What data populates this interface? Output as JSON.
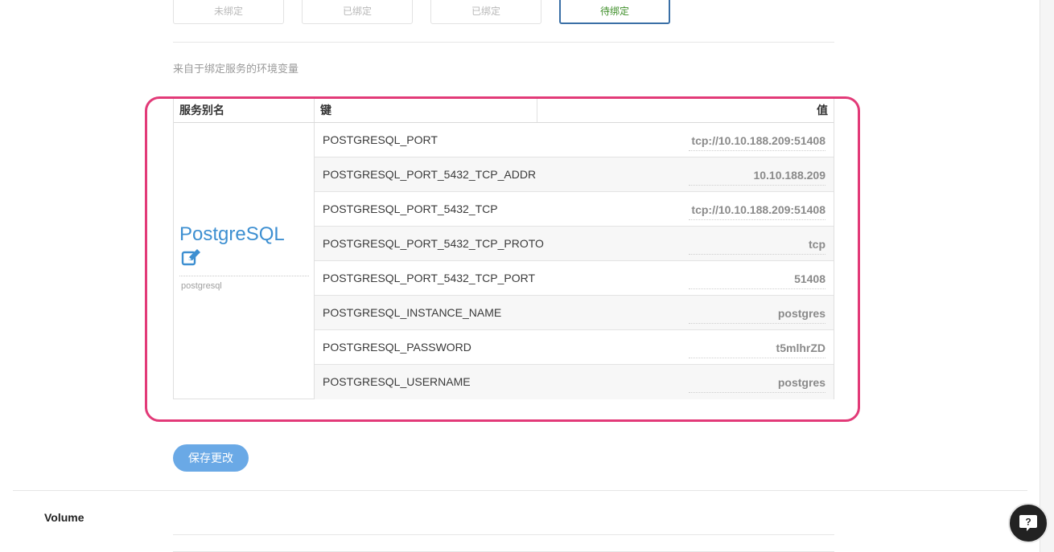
{
  "binding_tabs": [
    {
      "label": "未绑定",
      "active": false
    },
    {
      "label": "已绑定",
      "active": false
    },
    {
      "label": "已绑定",
      "active": false
    },
    {
      "label": "待绑定",
      "active": true
    }
  ],
  "env_section": {
    "label": "来自于绑定服务的环境变量",
    "table": {
      "headers": {
        "alias": "服务别名",
        "key": "键",
        "value": "值"
      },
      "service": {
        "name": "PostgreSQL",
        "id": "postgresql"
      },
      "rows": [
        {
          "key": "POSTGRESQL_PORT",
          "value": "tcp://10.10.188.209:51408"
        },
        {
          "key": "POSTGRESQL_PORT_5432_TCP_ADDR",
          "value": "10.10.188.209"
        },
        {
          "key": "POSTGRESQL_PORT_5432_TCP",
          "value": "tcp://10.10.188.209:51408"
        },
        {
          "key": "POSTGRESQL_PORT_5432_TCP_PROTO",
          "value": "tcp"
        },
        {
          "key": "POSTGRESQL_PORT_5432_TCP_PORT",
          "value": "51408"
        },
        {
          "key": "POSTGRESQL_INSTANCE_NAME",
          "value": "postgres"
        },
        {
          "key": "POSTGRESQL_PASSWORD",
          "value": "t5mlhrZD"
        },
        {
          "key": "POSTGRESQL_USERNAME",
          "value": "postgres"
        }
      ]
    }
  },
  "save_button": {
    "label": "保存更改"
  },
  "volume": {
    "title": "Volume"
  },
  "help": {
    "icon": "question-bubble-icon",
    "label": "?"
  },
  "colors": {
    "highlight": "#e23a78",
    "link": "#3d8fd1",
    "primary_button": "#6aa9e6",
    "active_tab_border": "#3a6fa6",
    "active_tab_text": "#3f8f2a"
  }
}
